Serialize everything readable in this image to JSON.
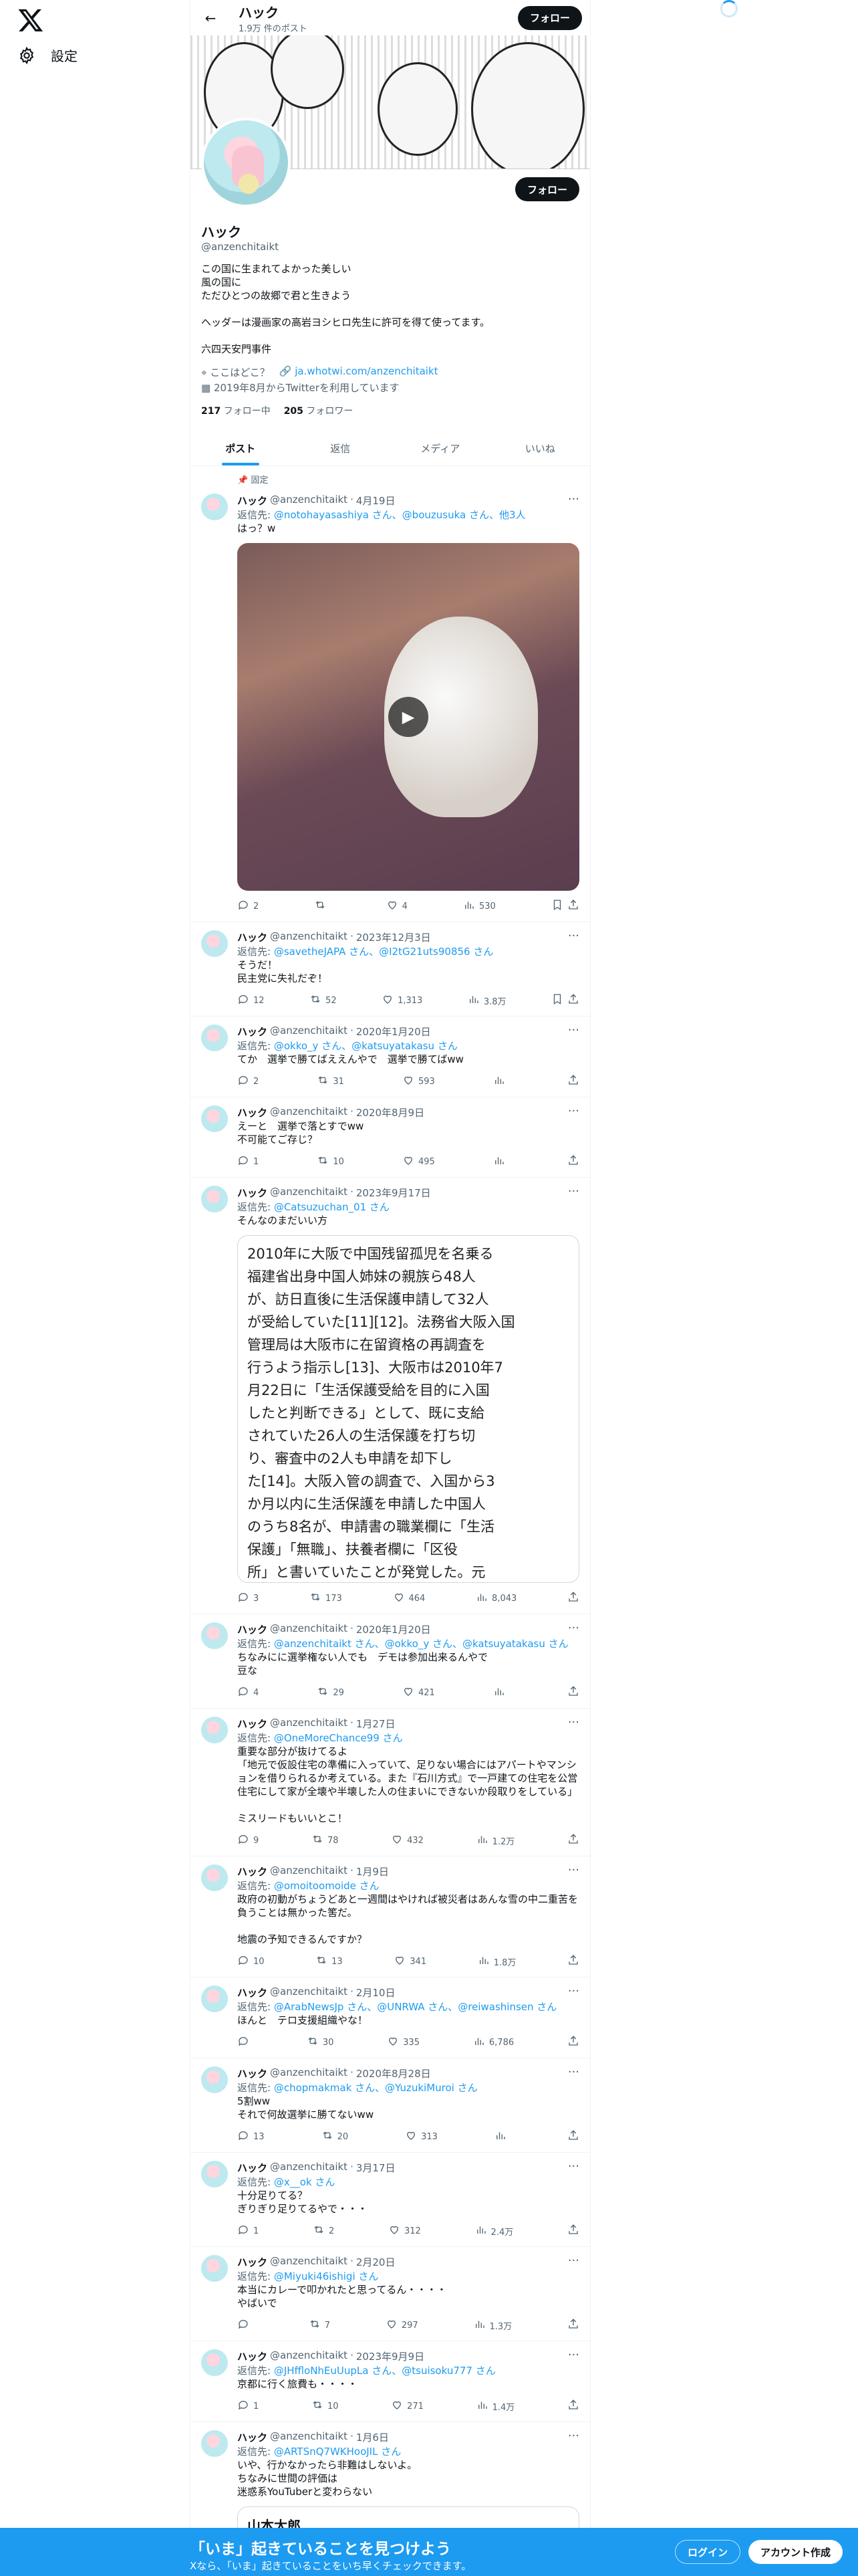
{
  "settings_label": "設定",
  "topbar": {
    "name": "ハック",
    "post_count": "1.9万 件のポスト",
    "follow": "フォロー"
  },
  "profile": {
    "name": "ハック",
    "handle": "@anzenchitaikt",
    "follow": "フォロー",
    "bio": [
      "この国に生まれてよかった美しい",
      "風の国に",
      "ただひとつの故郷で君と生きよう",
      "",
      "ヘッダーは漫画家の高岩ヨシヒロ先生に許可を得て使ってます。",
      "",
      "六四天安門事件"
    ],
    "location": "ここはどこ？",
    "link": "ja.whotwi.com/anzenchitaikt",
    "joined": "2019年8月からTwitterを利用しています",
    "following_count": "217",
    "following_label": "フォロー中",
    "followers_count": "205",
    "followers_label": "フォロワー"
  },
  "tabs": [
    "ポスト",
    "返信",
    "メディア",
    "いいね"
  ],
  "pinned_label": "固定",
  "tweets": [
    {
      "name": "ハック",
      "handle": "@anzenchitaikt",
      "date": "4月19日",
      "reply": "@notohayasashiya さん、@bouzusuka さん、他3人",
      "text": "はっ？w",
      "replies": "2",
      "retweets": "",
      "likes": "4",
      "views": "530"
    },
    {
      "name": "ハック",
      "handle": "@anzenchitaikt",
      "date": "2023年12月3日",
      "reply": "@savetheJAPA さん、@I2tG21uts90856 さん",
      "text": "そうだ！\n民主党に失礼だぞ！",
      "replies": "12",
      "retweets": "52",
      "likes": "1,313",
      "views": "3.8万"
    },
    {
      "name": "ハック",
      "handle": "@anzenchitaikt",
      "date": "2020年1月20日",
      "reply": "@okko_y さん、@katsuyatakasu さん",
      "text": "てか　選挙で勝てばええんやで　選挙で勝てばww",
      "replies": "2",
      "retweets": "31",
      "likes": "593",
      "views": ""
    },
    {
      "name": "ハック",
      "handle": "@anzenchitaikt",
      "date": "2020年8月9日",
      "reply": "",
      "text": "えーと　選挙で落とすでww\n不可能てご存じ？",
      "replies": "1",
      "retweets": "10",
      "likes": "495",
      "views": ""
    },
    {
      "name": "ハック",
      "handle": "@anzenchitaikt",
      "date": "2023年9月17日",
      "reply": "@Catsuzuchan_01 さん",
      "text": "そんなのまだいい方",
      "replies": "3",
      "retweets": "173",
      "likes": "464",
      "views": "8,043"
    },
    {
      "name": "ハック",
      "handle": "@anzenchitaikt",
      "date": "2020年1月20日",
      "reply": "@anzenchitaikt さん、@okko_y さん、@katsuyatakasu さん",
      "text": "ちなみにに選挙権ない人でも　デモは参加出来るんやで\n豆な",
      "replies": "4",
      "retweets": "29",
      "likes": "421",
      "views": ""
    },
    {
      "name": "ハック",
      "handle": "@anzenchitaikt",
      "date": "1月27日",
      "reply": "@OneMoreChance99 さん",
      "text": "重要な部分が抜けてるよ\n「地元で仮設住宅の準備に入っていて、足りない場合にはアパートやマンションを借りられるか考えている。また『石川方式』で一戸建ての住宅を公営住宅にして家が全壊や半壊した人の住まいにできないか段取りをしている」\n\nミスリードもいいとこ！",
      "replies": "9",
      "retweets": "78",
      "likes": "432",
      "views": "1.2万"
    },
    {
      "name": "ハック",
      "handle": "@anzenchitaikt",
      "date": "1月9日",
      "reply": "@omoitoomoide さん",
      "text": "政府の初動がちょうどあと一週間はやければ被災者はあんな雪の中二重苦を負うことは無かった筈だ。\n\n地震の予知できるんですか？",
      "replies": "10",
      "retweets": "13",
      "likes": "341",
      "views": "1.8万"
    },
    {
      "name": "ハック",
      "handle": "@anzenchitaikt",
      "date": "2月10日",
      "reply": "@ArabNewsJp さん、@UNRWA さん、@reiwashinsen さん",
      "text": "ほんと　テロ支援組織やな！",
      "replies": "",
      "retweets": "30",
      "likes": "335",
      "views": "6,786"
    },
    {
      "name": "ハック",
      "handle": "@anzenchitaikt",
      "date": "2020年8月28日",
      "reply": "@chopmakmak さん、@YuzukiMuroi さん",
      "text": "5割ww\nそれで何故選挙に勝てないww",
      "replies": "13",
      "retweets": "20",
      "likes": "313",
      "views": ""
    },
    {
      "name": "ハック",
      "handle": "@anzenchitaikt",
      "date": "3月17日",
      "reply": "@x__ok さん",
      "text": "十分足りてる？\nぎりぎり足りてるやで・・・",
      "replies": "1",
      "retweets": "2",
      "likes": "312",
      "views": "2.4万"
    },
    {
      "name": "ハック",
      "handle": "@anzenchitaikt",
      "date": "2月20日",
      "reply": "@Miyuki46ishigi さん",
      "text": "本当にカレーで叩かれたと思ってるん・・・・\nやばいで",
      "replies": "",
      "retweets": "7",
      "likes": "297",
      "views": "1.3万"
    },
    {
      "name": "ハック",
      "handle": "@anzenchitaikt",
      "date": "2023年9月9日",
      "reply": "@JHffloNhEuUupLa さん、@tsuisoku777 さん",
      "text": "京都に行く旅費も・・・・",
      "replies": "1",
      "retweets": "10",
      "likes": "271",
      "views": "1.4万"
    },
    {
      "name": "ハック",
      "handle": "@anzenchitaikt",
      "date": "1月6日",
      "reply": "@ARTSnQ7WKHooJIL さん",
      "text": "いや、行かなかったら非難はしないよ。\nちなみに世間の評価は\n迷惑系YouTuberと変わらない",
      "replies": "",
      "retweets": "",
      "likes": "",
      "views": ""
    }
  ],
  "quote_image_text": [
    "2010年に大阪で中国残留孤児を名乗る",
    "福建省出身中国人姉妹の親族ら48人",
    "が、訪日直後に生活保護申請して32人",
    "が受給していた[11][12]。法務省大阪入国",
    "管理局は大阪市に在留資格の再調査を",
    "行うよう指示し[13]、大阪市は2010年7",
    "月22日に「生活保護受給を目的に入国",
    "したと判断できる」として、既に支給",
    "されていた26人の生活保護を打ち切",
    "り、審査中の2人も申請を却下し",
    "た[14]。大阪入管の調査で、入国から3",
    "か月以内に生活保護を申請した中国人",
    "のうち8名が、申請書の職業欄に「生活",
    "保護」「無職」、扶養者欄に「区役",
    "所」と書いていたことが発覚した。元"
  ],
  "quote_card_title": "山本太郎",
  "bottom": {
    "title": "「いま」起きていることを見つけよう",
    "subtitle": "Xなら、「いま」起きていることをいち早くチェックできます。",
    "login": "ログイン",
    "signup": "アカウント作成"
  }
}
